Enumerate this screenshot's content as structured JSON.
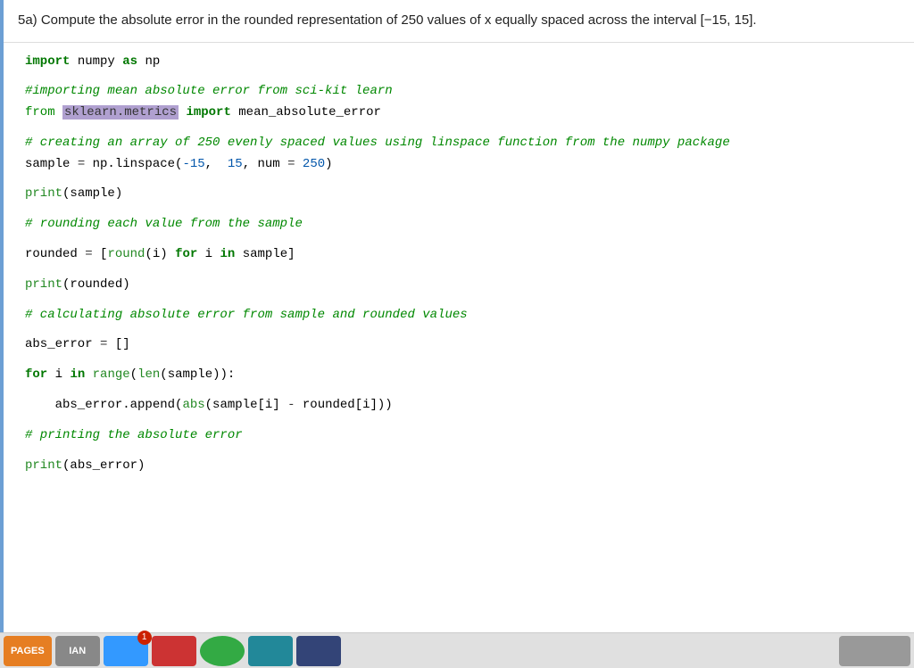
{
  "problem": {
    "text": "5a) Compute the absolute error in the rounded representation of 250 values of x equally spaced across the interval [−15, 15]."
  },
  "code": {
    "lines": [
      {
        "id": "line1",
        "content": "import_numpy",
        "type": "code"
      },
      {
        "id": "blank1",
        "type": "blank"
      },
      {
        "id": "blank2",
        "type": "blank"
      },
      {
        "id": "comment1",
        "content": "#importing mean absolute error from sci-kit learn",
        "type": "comment"
      },
      {
        "id": "line2",
        "content": "from_sklearn",
        "type": "code"
      },
      {
        "id": "blank3",
        "type": "blank"
      },
      {
        "id": "comment2",
        "content": "# creating an array of 250 evenly spaced values using linspace function from the numpy package",
        "type": "comment"
      },
      {
        "id": "line3",
        "content": "sample_linspace",
        "type": "code"
      },
      {
        "id": "blank4",
        "type": "blank"
      },
      {
        "id": "line4",
        "content": "print_sample",
        "type": "code"
      },
      {
        "id": "blank5",
        "type": "blank"
      },
      {
        "id": "comment3",
        "content": "# rounding each value from the sample",
        "type": "comment"
      },
      {
        "id": "blank6",
        "type": "blank"
      },
      {
        "id": "line5",
        "content": "rounded_list",
        "type": "code"
      },
      {
        "id": "blank7",
        "type": "blank"
      },
      {
        "id": "line6",
        "content": "print_rounded",
        "type": "code"
      },
      {
        "id": "blank8",
        "type": "blank"
      },
      {
        "id": "comment4",
        "content": "# calculating absolute error from sample and rounded values",
        "type": "comment"
      },
      {
        "id": "blank9",
        "type": "blank"
      },
      {
        "id": "line7",
        "content": "abs_error_init",
        "type": "code"
      },
      {
        "id": "blank10",
        "type": "blank"
      },
      {
        "id": "line8",
        "content": "for_loop",
        "type": "code"
      },
      {
        "id": "blank11",
        "type": "blank"
      },
      {
        "id": "line9",
        "content": "append_abs",
        "type": "code"
      },
      {
        "id": "blank12",
        "type": "blank"
      },
      {
        "id": "comment5",
        "content": "# printing the absolute error",
        "type": "comment"
      },
      {
        "id": "blank13",
        "type": "blank"
      },
      {
        "id": "line10",
        "content": "print_abs_error",
        "type": "code"
      }
    ]
  },
  "taskbar": {
    "items": [
      {
        "label": "PAGES",
        "color": "#e67e22"
      },
      {
        "label": "IAN",
        "color": "#888888"
      },
      {
        "label": "1",
        "color": "#3399ff",
        "badge": true
      },
      {
        "label": "",
        "color": "#cc3333"
      },
      {
        "label": "",
        "color": "#33aa44"
      },
      {
        "label": "",
        "color": "#228899"
      },
      {
        "label": "",
        "color": "#334488"
      }
    ]
  }
}
